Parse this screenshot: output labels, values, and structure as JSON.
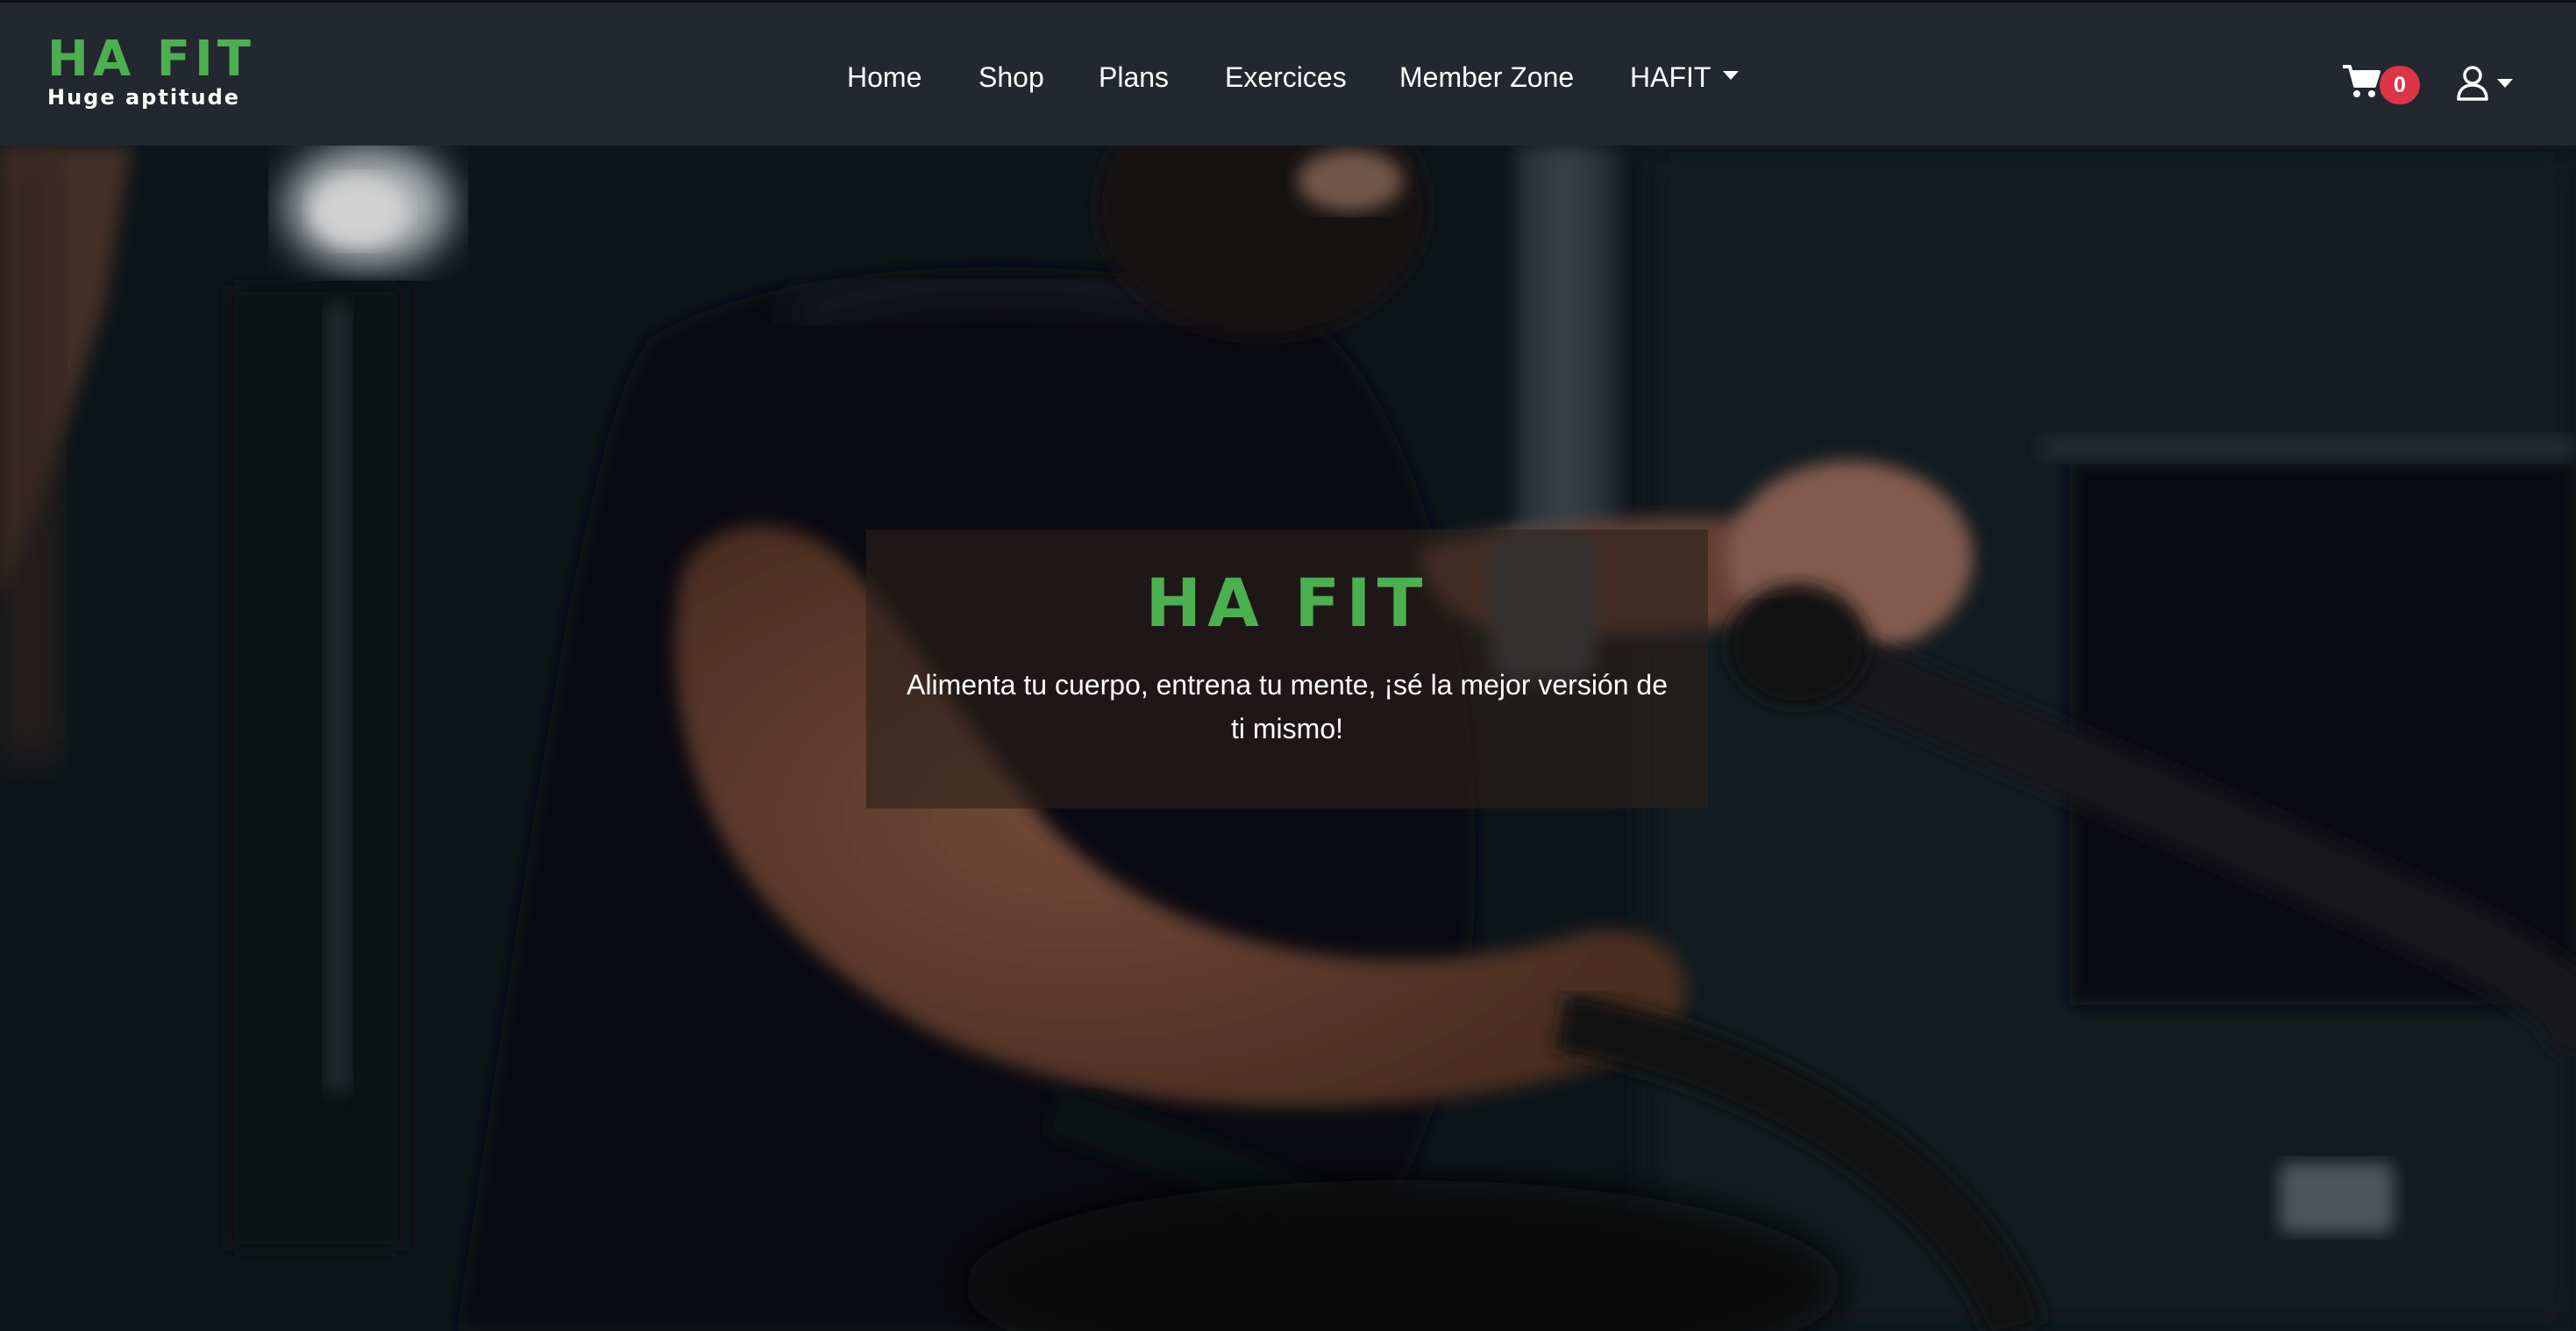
{
  "brand": {
    "title": "HA FIT",
    "subtitle": "Huge aptitude",
    "accent_color": "#4caf50"
  },
  "nav": {
    "items": [
      {
        "label": "Home"
      },
      {
        "label": "Shop"
      },
      {
        "label": "Plans"
      },
      {
        "label": "Exercices"
      },
      {
        "label": "Member Zone"
      },
      {
        "label": "HAFIT",
        "dropdown": true
      }
    ]
  },
  "cart": {
    "icon": "cart-icon",
    "count": "0",
    "badge_color": "#dc3545"
  },
  "user": {
    "icon": "user-icon",
    "dropdown": true
  },
  "hero": {
    "title": "HA FIT",
    "tagline": "Alimenta tu cuerpo, entrena tu mente, ¡sé la mejor versión de ti mismo!",
    "background": "fitness-video-background"
  },
  "colors": {
    "navbar_bg": "#23272f",
    "text": "#ffffff"
  }
}
